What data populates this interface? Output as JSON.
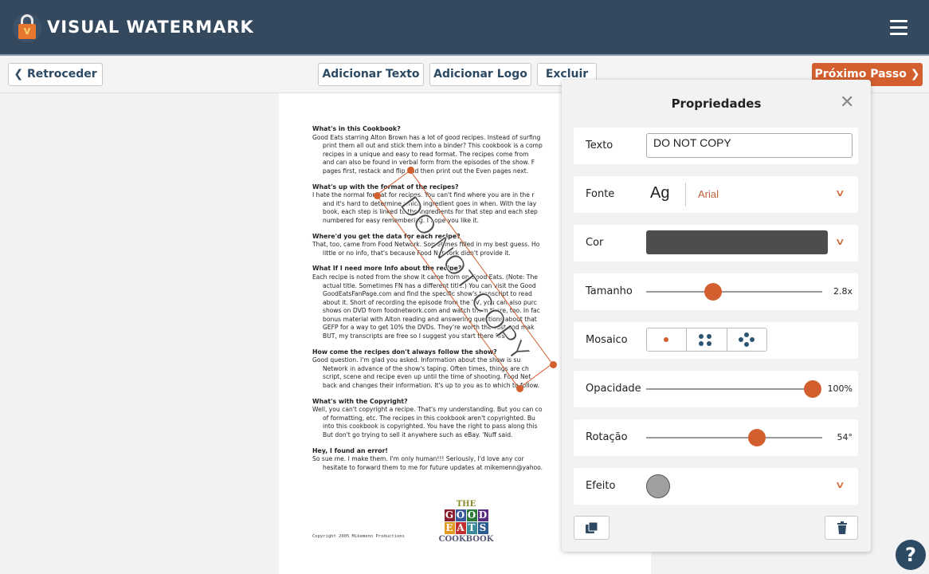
{
  "app": {
    "title": "VISUAL WATERMARK",
    "logo_letter": "V"
  },
  "toolbar": {
    "back": "Retroceder",
    "add_text": "Adicionar Texto",
    "add_logo": "Adicionar Logo",
    "delete": "Excluir",
    "next": "Próximo Passo"
  },
  "document": {
    "sections": [
      {
        "heading": "What's in this Cookbook?",
        "lines": [
          "Good Eats starring Alton Brown has a lot of good recipes. Instead of surfing",
          "print them all out and stick them into a binder? This cookbook is a comp",
          "recipes in a unique and easy to read format. The recipes come from",
          "and can also be found in verbal form from the episodes of the show. F",
          "pages first, restack and flip and then print out the Even pages next."
        ]
      },
      {
        "heading": "What's up with the format of the recipes?",
        "lines": [
          "I hate the normal format for recipes. You can't find where you are in the r",
          "and it's hard to determine which ingredient goes in when. With the lay",
          "book, each step is linked to the ingredients for that step and each step",
          "numbered for easy remembering. I hope you like it."
        ]
      },
      {
        "heading": "Where'd you get the data for each recipe?",
        "lines": [
          "That, too, came from Food Network. Sometimes filled in my best guess. Ho",
          "little or no info, that's because Food Network didn't provide it."
        ]
      },
      {
        "heading": "What If I need more Info about the recipe?",
        "lines": [
          "Each recipe is noted from the show it came from on Good Eats. (Note: The",
          "actual title. Sometimes FN has a different title.) You can visit the Good",
          "GoodEatsFanPage.com and find the specific show's transcript to read",
          "about it. Short of recording the episode from the TV, you can also purc",
          "shows on DVD from foodnetwork.com and watch them there, too. In fac",
          "bonus material with Alton reading and answering questions about that",
          "GEFP for a way to get 10% the DVDs. They're worth the cost and mak",
          "BUT, my transcripts are free so I suggest you start there first."
        ]
      },
      {
        "heading": "How come the recipes don't always follow the show?",
        "lines": [
          "Good question. I'm glad you asked. Information about the show is su",
          "Network in advance of the show's taping. Often times, things are ch",
          "script, scene and recipe even up until the time of shooting. Food Net",
          "back and changes their information. It's up to you as to which to follow."
        ]
      },
      {
        "heading": "What's with the Copyright?",
        "lines": [
          "Well, you can't copyright a recipe. That's my understanding. But you can co",
          "of formatting, etc. The recipes in this cookbook aren't copyrighted. Bu",
          "into this cookbook is copyrighted. You have the right to pass along this",
          "But don't go trying to sell it anywhere such as eBay. 'Nuff said."
        ]
      },
      {
        "heading": "Hey, I found an error!",
        "lines": [
          "So sue me. I make them. I'm only human!!! Seriously, I'd love any cor",
          "hesitate to forward them to me for future updates at mikemenn@yahoo."
        ]
      }
    ],
    "copyright": "Copyright 2005 Mikemenn Productions",
    "logo_text": "THE GOOD EATS COOKBOOK"
  },
  "watermark": {
    "text": "DO NOT COPY",
    "rotation_deg": 54
  },
  "panel": {
    "title": "Propriedades",
    "text_label": "Texto",
    "text_value": "DO NOT COPY",
    "font_label": "Fonte",
    "font_preview": "Ag",
    "font_value": "Arial",
    "color_label": "Cor",
    "color_value": "#4d4d4d",
    "size_label": "Tamanho",
    "size_value": "2.8x",
    "size_fraction": 0.38,
    "mosaic_label": "Mosaico",
    "mosaic_options": [
      "single",
      "grid-4",
      "diamond-5"
    ],
    "mosaic_selected": "single",
    "opacity_label": "Opacidade",
    "opacity_value": "100%",
    "opacity_fraction": 1.0,
    "rotation_label": "Rotação",
    "rotation_value": "54°",
    "rotation_fraction": 0.63,
    "effect_label": "Efeito"
  },
  "colors": {
    "header": "#34495e",
    "accent": "#d35f2f",
    "icon": "#2c4a63"
  }
}
